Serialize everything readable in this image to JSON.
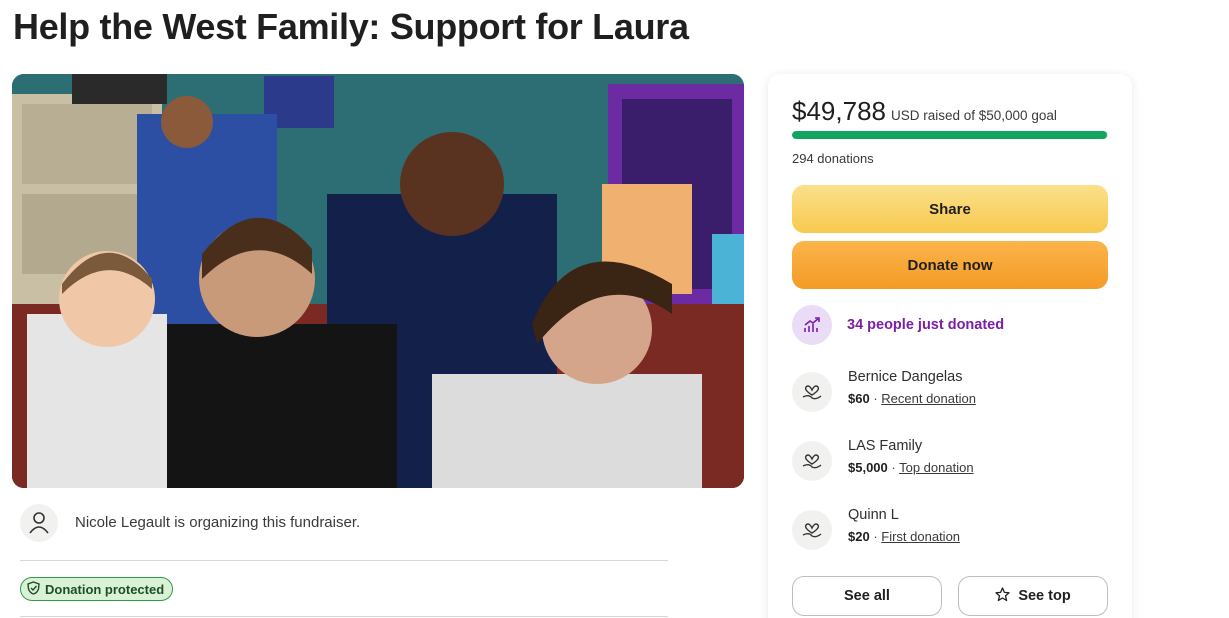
{
  "page": {
    "title": "Help the West Family: Support for Laura"
  },
  "organizer": {
    "text": "Nicole Legault is organizing this fundraiser."
  },
  "badge": {
    "label": "Donation protected"
  },
  "donation_card": {
    "amount": "$49,788",
    "goal_text": "USD raised of $50,000 goal",
    "progress_fraction": 0.9958,
    "donations_count": "294 donations",
    "share_label": "Share",
    "donate_label": "Donate now",
    "trend_text": "34 people just donated",
    "donors": [
      {
        "name": "Bernice Dangelas",
        "amount": "$60",
        "sep": " · ",
        "tag": "Recent donation"
      },
      {
        "name": "LAS Family",
        "amount": "$5,000",
        "sep": " · ",
        "tag": "Top donation"
      },
      {
        "name": "Quinn L",
        "amount": "$20",
        "sep": " · ",
        "tag": "First donation"
      }
    ],
    "see_all_label": "See all",
    "see_top_label": "See top"
  },
  "colors": {
    "progress": "#11a560",
    "trend": "#7a1fa8",
    "share": "#f7c94f",
    "donate": "#f49a26",
    "badge_border": "#2f9a4a"
  },
  "icons": [
    "person-icon",
    "shield-check-icon",
    "trend-up-icon",
    "heart-hand-icon",
    "star-icon"
  ]
}
